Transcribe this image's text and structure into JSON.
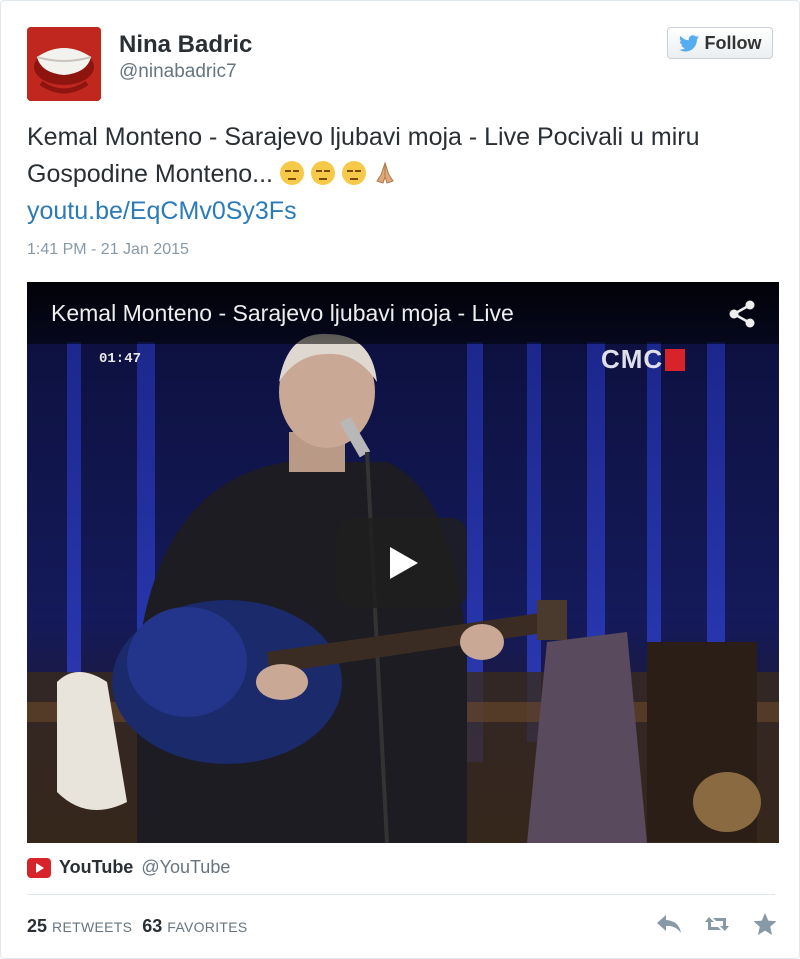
{
  "user": {
    "name": "Nina Badric",
    "handle": "@ninabadric7"
  },
  "follow_button": {
    "label": "Follow"
  },
  "tweet": {
    "text": "Kemal Monteno - Sarajevo ljubavi moja - Live Pocivali u miru Gospodine Monteno...",
    "emojis": [
      "pensive-face",
      "pensive-face",
      "pensive-face",
      "folded-hands"
    ],
    "link": "youtu.be/EqCMv0Sy3Fs",
    "timestamp": "1:41 PM - 21 Jan 2015"
  },
  "video": {
    "title": "Kemal Monteno - Sarajevo ljubavi moja - Live",
    "timecode": "01:47",
    "channel_logo": "CMC"
  },
  "source": {
    "name": "YouTube",
    "handle": "@YouTube"
  },
  "stats": {
    "retweets_count": "25",
    "retweets_label": "RETWEETS",
    "favorites_count": "63",
    "favorites_label": "FAVORITES"
  },
  "colors": {
    "link": "#2b7bb9",
    "twitter_blue": "#55acee",
    "youtube_red": "#d8232a"
  }
}
